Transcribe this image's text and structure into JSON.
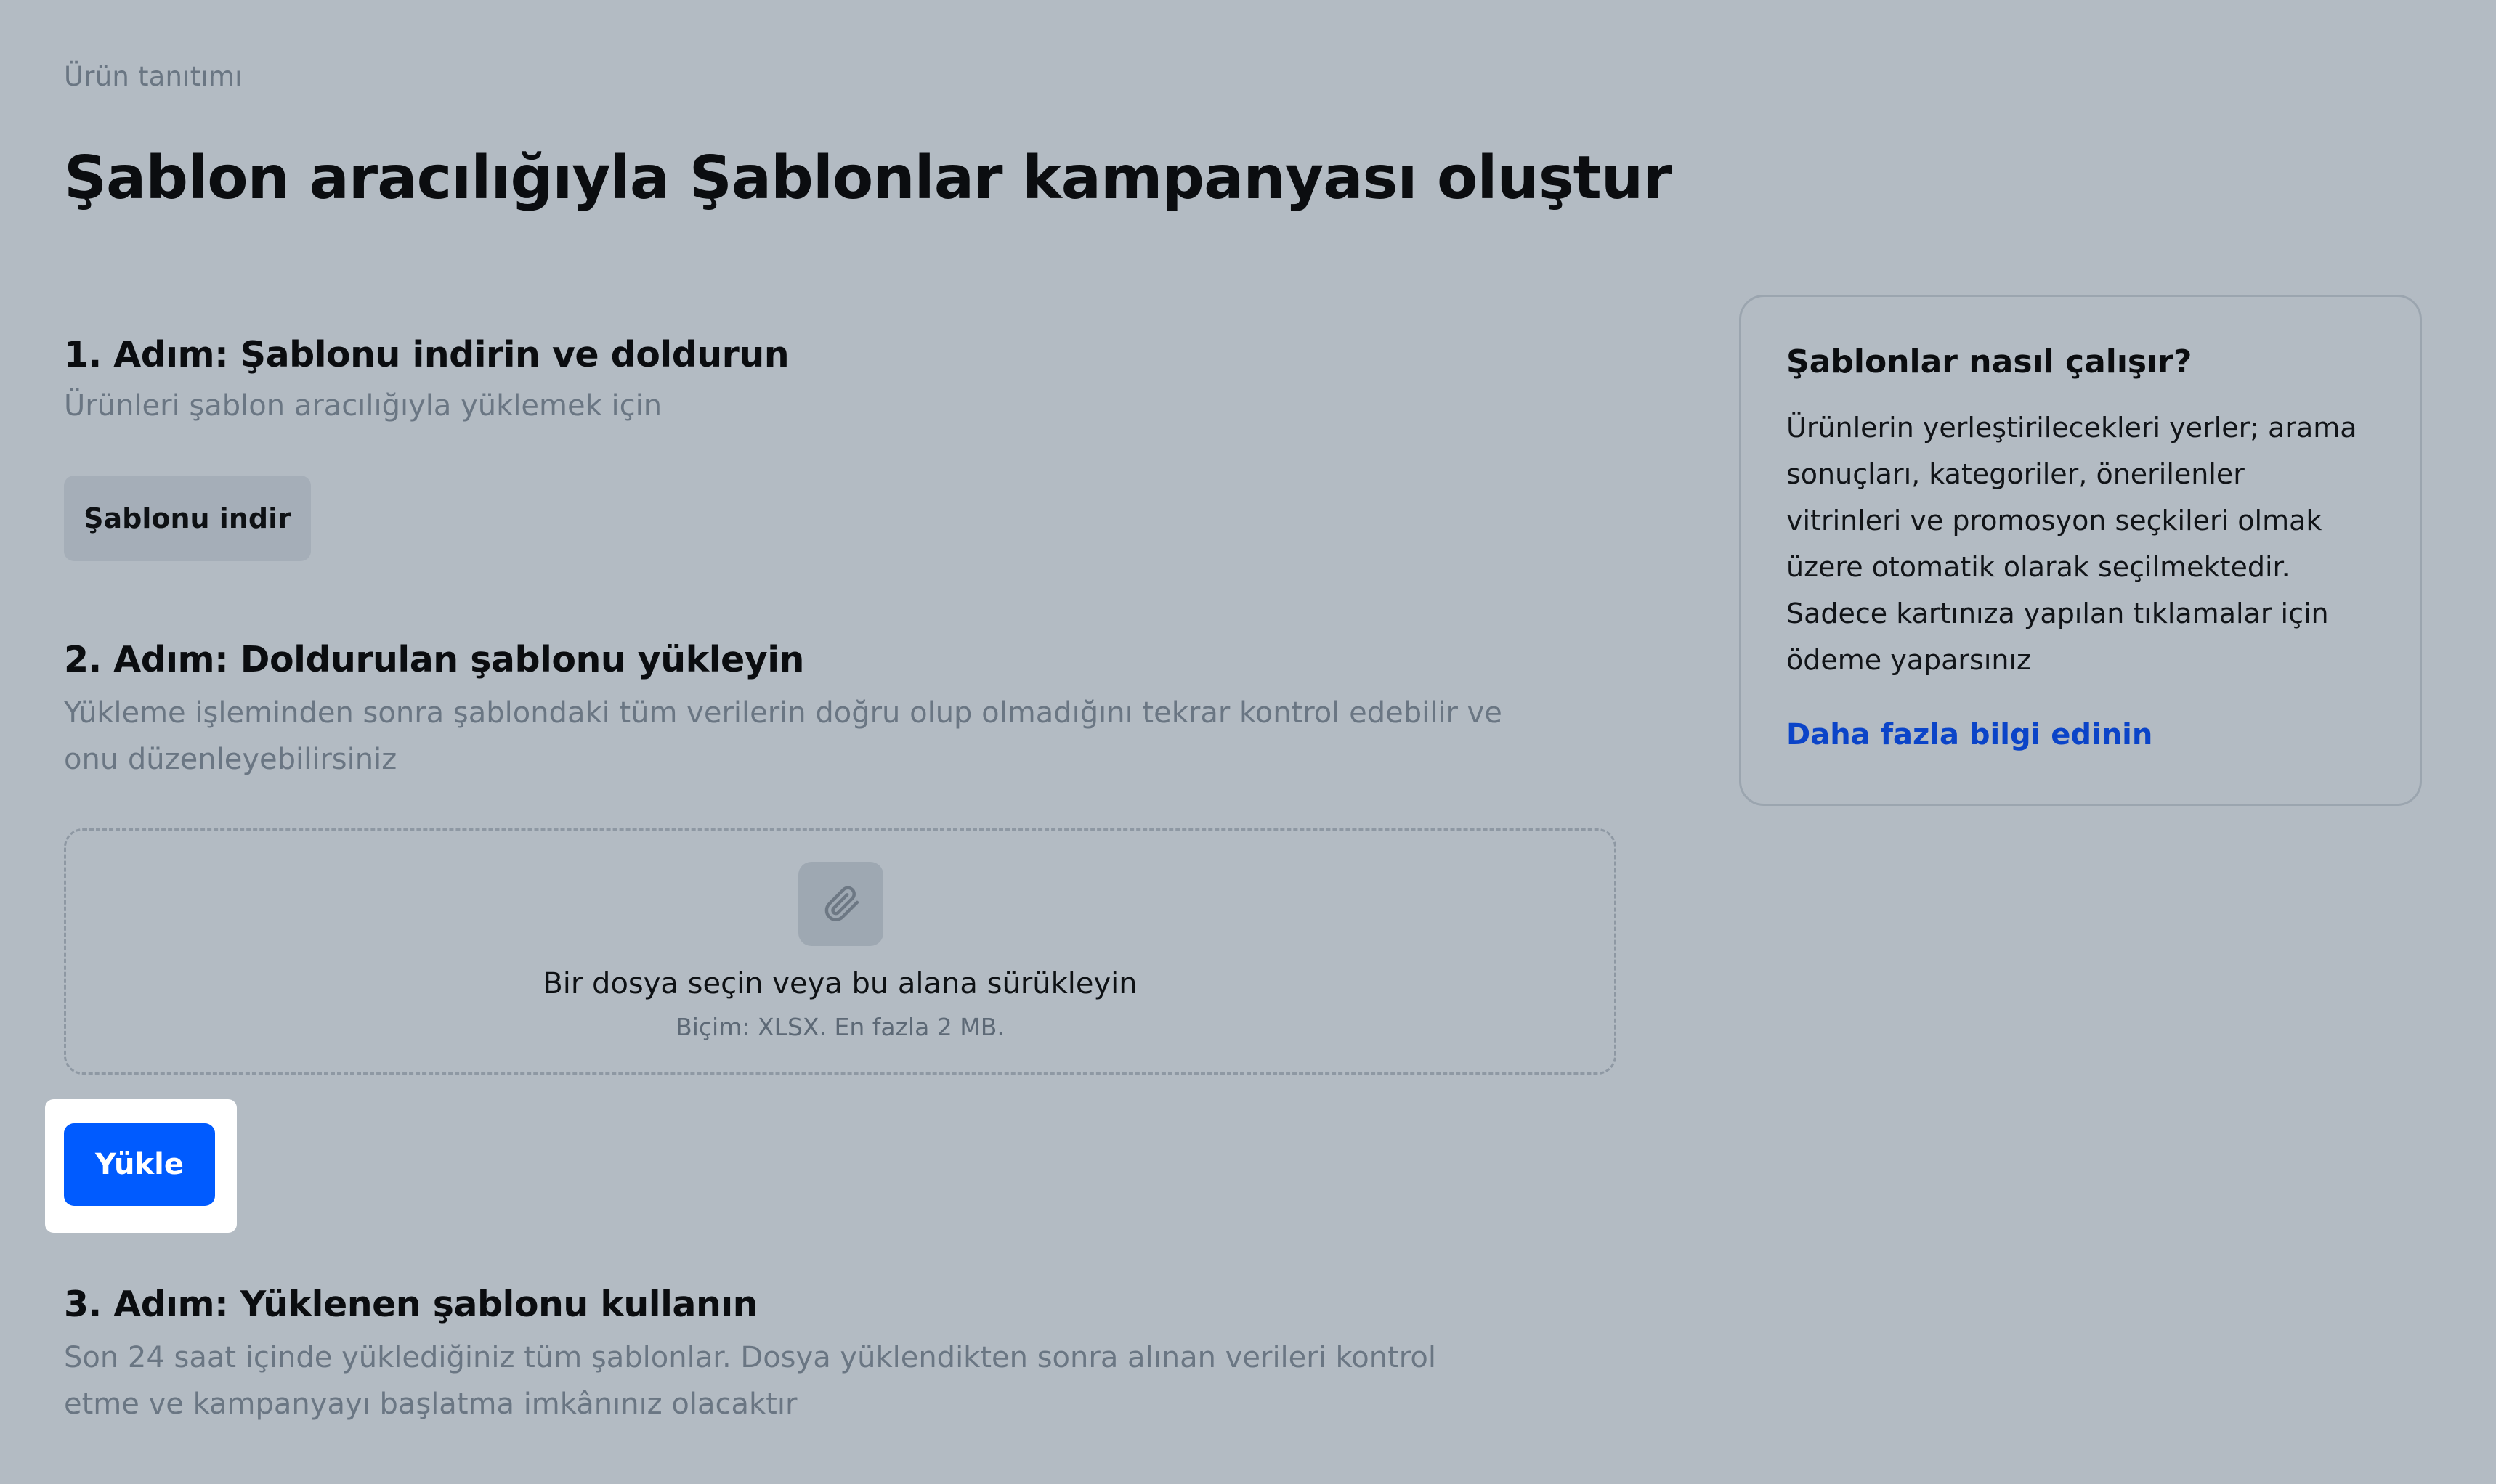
{
  "breadcrumb": "Ürün tanıtımı",
  "page_title": "Şablon aracılığıyla Şablonlar kampanyası oluştur",
  "step1": {
    "title": "1. Adım: Şablonu indirin ve doldurun",
    "description": "Ürünleri şablon aracılığıyla yüklemek için",
    "download_label": "Şablonu indir"
  },
  "step2": {
    "title": "2. Adım: Doldurulan şablonu yükleyin",
    "description": "Yükleme işleminden sonra şablondaki tüm verilerin doğru olup olmadığını tekrar kontrol edebilir ve onu düzenleyebilirsiniz",
    "dropzone": {
      "icon": "paperclip-icon",
      "main_text": "Bir dosya seçin veya bu alana sürükleyin",
      "sub_text": "Biçim: XLSX. En fazla 2 MB."
    },
    "upload_label": "Yükle"
  },
  "step3": {
    "title": "3. Adım: Yüklenen şablonu kullanın",
    "description": "Son 24 saat içinde yüklediğiniz tüm şablonlar. Dosya yüklendikten sonra alınan verileri kontrol etme ve kampanyayı başlatma imkânınız olacaktır"
  },
  "info_card": {
    "title": "Şablonlar nasıl çalışır?",
    "text": "Ürünlerin yerleştirilecekleri yerler; arama sonuçları, kategoriler, önerilenler vitrinleri ve promosyon seçkileri olmak üzere otomatik olarak seçilmektedir. Sadece kartınıza yapılan tıklamalar için ödeme yaparsınız",
    "link": "Daha fazla bilgi edinin"
  },
  "colors": {
    "background": "#b3bbc3",
    "primary_button": "#005bff",
    "link": "#0b44c8"
  }
}
